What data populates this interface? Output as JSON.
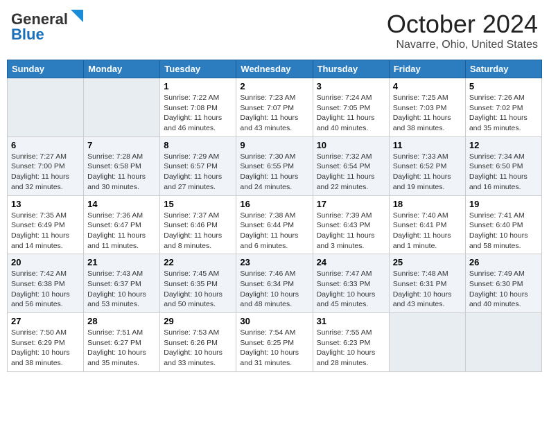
{
  "header": {
    "logo_general": "General",
    "logo_blue": "Blue",
    "month_title": "October 2024",
    "location": "Navarre, Ohio, United States"
  },
  "days_of_week": [
    "Sunday",
    "Monday",
    "Tuesday",
    "Wednesday",
    "Thursday",
    "Friday",
    "Saturday"
  ],
  "weeks": [
    [
      {
        "num": "",
        "sunrise": "",
        "sunset": "",
        "daylight": ""
      },
      {
        "num": "",
        "sunrise": "",
        "sunset": "",
        "daylight": ""
      },
      {
        "num": "1",
        "sunrise": "Sunrise: 7:22 AM",
        "sunset": "Sunset: 7:08 PM",
        "daylight": "Daylight: 11 hours and 46 minutes."
      },
      {
        "num": "2",
        "sunrise": "Sunrise: 7:23 AM",
        "sunset": "Sunset: 7:07 PM",
        "daylight": "Daylight: 11 hours and 43 minutes."
      },
      {
        "num": "3",
        "sunrise": "Sunrise: 7:24 AM",
        "sunset": "Sunset: 7:05 PM",
        "daylight": "Daylight: 11 hours and 40 minutes."
      },
      {
        "num": "4",
        "sunrise": "Sunrise: 7:25 AM",
        "sunset": "Sunset: 7:03 PM",
        "daylight": "Daylight: 11 hours and 38 minutes."
      },
      {
        "num": "5",
        "sunrise": "Sunrise: 7:26 AM",
        "sunset": "Sunset: 7:02 PM",
        "daylight": "Daylight: 11 hours and 35 minutes."
      }
    ],
    [
      {
        "num": "6",
        "sunrise": "Sunrise: 7:27 AM",
        "sunset": "Sunset: 7:00 PM",
        "daylight": "Daylight: 11 hours and 32 minutes."
      },
      {
        "num": "7",
        "sunrise": "Sunrise: 7:28 AM",
        "sunset": "Sunset: 6:58 PM",
        "daylight": "Daylight: 11 hours and 30 minutes."
      },
      {
        "num": "8",
        "sunrise": "Sunrise: 7:29 AM",
        "sunset": "Sunset: 6:57 PM",
        "daylight": "Daylight: 11 hours and 27 minutes."
      },
      {
        "num": "9",
        "sunrise": "Sunrise: 7:30 AM",
        "sunset": "Sunset: 6:55 PM",
        "daylight": "Daylight: 11 hours and 24 minutes."
      },
      {
        "num": "10",
        "sunrise": "Sunrise: 7:32 AM",
        "sunset": "Sunset: 6:54 PM",
        "daylight": "Daylight: 11 hours and 22 minutes."
      },
      {
        "num": "11",
        "sunrise": "Sunrise: 7:33 AM",
        "sunset": "Sunset: 6:52 PM",
        "daylight": "Daylight: 11 hours and 19 minutes."
      },
      {
        "num": "12",
        "sunrise": "Sunrise: 7:34 AM",
        "sunset": "Sunset: 6:50 PM",
        "daylight": "Daylight: 11 hours and 16 minutes."
      }
    ],
    [
      {
        "num": "13",
        "sunrise": "Sunrise: 7:35 AM",
        "sunset": "Sunset: 6:49 PM",
        "daylight": "Daylight: 11 hours and 14 minutes."
      },
      {
        "num": "14",
        "sunrise": "Sunrise: 7:36 AM",
        "sunset": "Sunset: 6:47 PM",
        "daylight": "Daylight: 11 hours and 11 minutes."
      },
      {
        "num": "15",
        "sunrise": "Sunrise: 7:37 AM",
        "sunset": "Sunset: 6:46 PM",
        "daylight": "Daylight: 11 hours and 8 minutes."
      },
      {
        "num": "16",
        "sunrise": "Sunrise: 7:38 AM",
        "sunset": "Sunset: 6:44 PM",
        "daylight": "Daylight: 11 hours and 6 minutes."
      },
      {
        "num": "17",
        "sunrise": "Sunrise: 7:39 AM",
        "sunset": "Sunset: 6:43 PM",
        "daylight": "Daylight: 11 hours and 3 minutes."
      },
      {
        "num": "18",
        "sunrise": "Sunrise: 7:40 AM",
        "sunset": "Sunset: 6:41 PM",
        "daylight": "Daylight: 11 hours and 1 minute."
      },
      {
        "num": "19",
        "sunrise": "Sunrise: 7:41 AM",
        "sunset": "Sunset: 6:40 PM",
        "daylight": "Daylight: 10 hours and 58 minutes."
      }
    ],
    [
      {
        "num": "20",
        "sunrise": "Sunrise: 7:42 AM",
        "sunset": "Sunset: 6:38 PM",
        "daylight": "Daylight: 10 hours and 56 minutes."
      },
      {
        "num": "21",
        "sunrise": "Sunrise: 7:43 AM",
        "sunset": "Sunset: 6:37 PM",
        "daylight": "Daylight: 10 hours and 53 minutes."
      },
      {
        "num": "22",
        "sunrise": "Sunrise: 7:45 AM",
        "sunset": "Sunset: 6:35 PM",
        "daylight": "Daylight: 10 hours and 50 minutes."
      },
      {
        "num": "23",
        "sunrise": "Sunrise: 7:46 AM",
        "sunset": "Sunset: 6:34 PM",
        "daylight": "Daylight: 10 hours and 48 minutes."
      },
      {
        "num": "24",
        "sunrise": "Sunrise: 7:47 AM",
        "sunset": "Sunset: 6:33 PM",
        "daylight": "Daylight: 10 hours and 45 minutes."
      },
      {
        "num": "25",
        "sunrise": "Sunrise: 7:48 AM",
        "sunset": "Sunset: 6:31 PM",
        "daylight": "Daylight: 10 hours and 43 minutes."
      },
      {
        "num": "26",
        "sunrise": "Sunrise: 7:49 AM",
        "sunset": "Sunset: 6:30 PM",
        "daylight": "Daylight: 10 hours and 40 minutes."
      }
    ],
    [
      {
        "num": "27",
        "sunrise": "Sunrise: 7:50 AM",
        "sunset": "Sunset: 6:29 PM",
        "daylight": "Daylight: 10 hours and 38 minutes."
      },
      {
        "num": "28",
        "sunrise": "Sunrise: 7:51 AM",
        "sunset": "Sunset: 6:27 PM",
        "daylight": "Daylight: 10 hours and 35 minutes."
      },
      {
        "num": "29",
        "sunrise": "Sunrise: 7:53 AM",
        "sunset": "Sunset: 6:26 PM",
        "daylight": "Daylight: 10 hours and 33 minutes."
      },
      {
        "num": "30",
        "sunrise": "Sunrise: 7:54 AM",
        "sunset": "Sunset: 6:25 PM",
        "daylight": "Daylight: 10 hours and 31 minutes."
      },
      {
        "num": "31",
        "sunrise": "Sunrise: 7:55 AM",
        "sunset": "Sunset: 6:23 PM",
        "daylight": "Daylight: 10 hours and 28 minutes."
      },
      {
        "num": "",
        "sunrise": "",
        "sunset": "",
        "daylight": ""
      },
      {
        "num": "",
        "sunrise": "",
        "sunset": "",
        "daylight": ""
      }
    ]
  ]
}
